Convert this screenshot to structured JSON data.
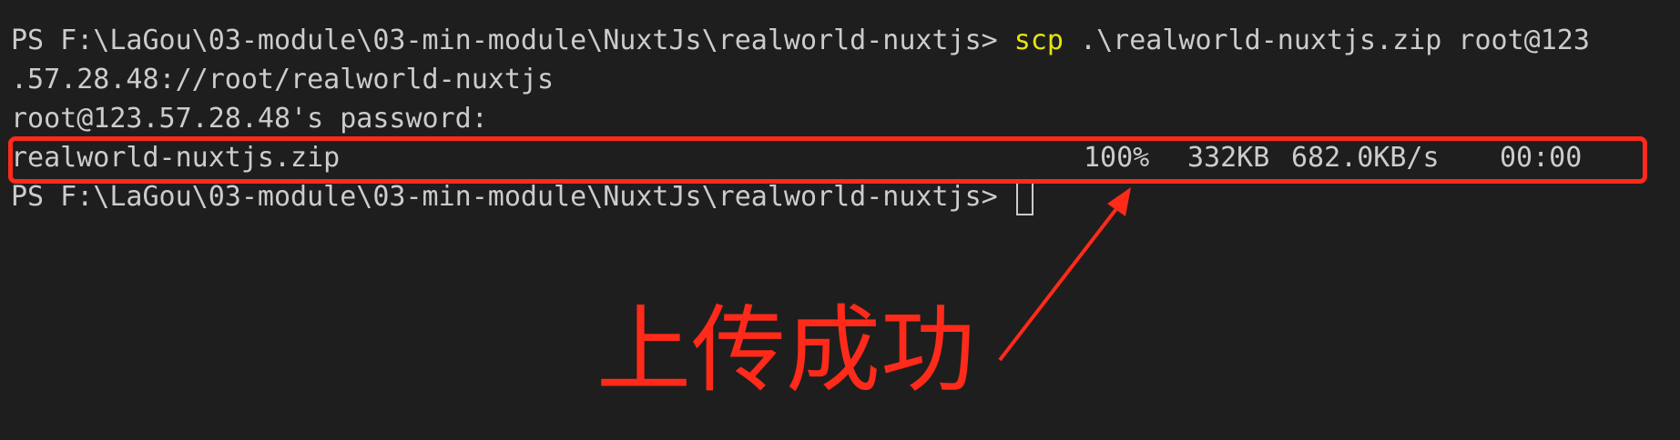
{
  "terminal": {
    "line1": {
      "prompt": "PS F:\\LaGou\\03-module\\03-min-module\\NuxtJs\\realworld-nuxtjs> ",
      "command": "scp",
      "args": " .\\realworld-nuxtjs.zip root@123"
    },
    "line2": ".57.28.48://root/realworld-nuxtjs",
    "line3": "root@123.57.28.48's password:",
    "transfer": {
      "filename": "realworld-nuxtjs.zip",
      "percent": "100%",
      "size": "332KB",
      "speed": "682.0KB/s",
      "eta": "00:00"
    },
    "line5": {
      "prompt": "PS F:\\LaGou\\03-module\\03-min-module\\NuxtJs\\realworld-nuxtjs> "
    }
  },
  "annotation": {
    "text": "上传成功",
    "color": "#ff2a1a"
  },
  "colors": {
    "background": "#1e1e1e",
    "foreground": "#cccccc",
    "command_highlight": "#e5e510"
  }
}
